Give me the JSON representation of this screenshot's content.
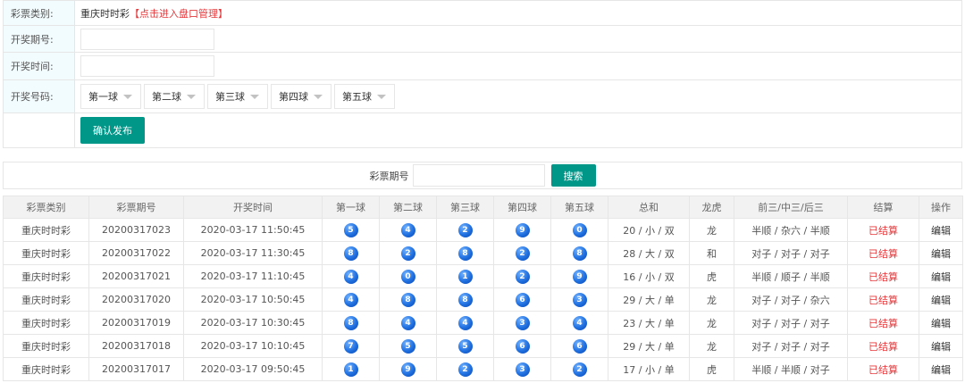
{
  "form": {
    "category_label": "彩票类别:",
    "category_value": "重庆时时彩",
    "category_link": "【点击进入盘口管理】",
    "issue_label": "开奖期号:",
    "time_label": "开奖时间:",
    "numbers_label": "开奖号码:",
    "ball_selects": [
      "第一球",
      "第二球",
      "第三球",
      "第四球",
      "第五球"
    ],
    "submit_label": "确认发布"
  },
  "search": {
    "label": "彩票期号",
    "button": "搜索"
  },
  "table": {
    "headers": [
      "彩票类别",
      "彩票期号",
      "开奖时间",
      "第一球",
      "第二球",
      "第三球",
      "第四球",
      "第五球",
      "总和",
      "龙虎",
      "前三/中三/后三",
      "结算",
      "操作"
    ],
    "rows": [
      {
        "category": "重庆时时彩",
        "issue": "20200317023",
        "time": "2020-03-17 11:50:45",
        "balls": [
          "5",
          "4",
          "2",
          "9",
          "0"
        ],
        "sum": "20 / 小 / 双",
        "dragon_tiger": "龙",
        "pattern": "半顺 / 杂六 / 半顺",
        "status": "已结算",
        "action": "编辑"
      },
      {
        "category": "重庆时时彩",
        "issue": "20200317022",
        "time": "2020-03-17 11:30:45",
        "balls": [
          "8",
          "2",
          "8",
          "2",
          "8"
        ],
        "sum": "28 / 大 / 双",
        "dragon_tiger": "和",
        "pattern": "对子 / 对子 / 对子",
        "status": "已结算",
        "action": "编辑"
      },
      {
        "category": "重庆时时彩",
        "issue": "20200317021",
        "time": "2020-03-17 11:10:45",
        "balls": [
          "4",
          "0",
          "1",
          "2",
          "9"
        ],
        "sum": "16 / 小 / 双",
        "dragon_tiger": "虎",
        "pattern": "半顺 / 顺子 / 半顺",
        "status": "已结算",
        "action": "编辑"
      },
      {
        "category": "重庆时时彩",
        "issue": "20200317020",
        "time": "2020-03-17 10:50:45",
        "balls": [
          "4",
          "8",
          "8",
          "6",
          "3"
        ],
        "sum": "29 / 大 / 单",
        "dragon_tiger": "龙",
        "pattern": "对子 / 对子 / 杂六",
        "status": "已结算",
        "action": "编辑"
      },
      {
        "category": "重庆时时彩",
        "issue": "20200317019",
        "time": "2020-03-17 10:30:45",
        "balls": [
          "8",
          "4",
          "4",
          "3",
          "4"
        ],
        "sum": "23 / 大 / 单",
        "dragon_tiger": "龙",
        "pattern": "对子 / 对子 / 对子",
        "status": "已结算",
        "action": "编辑"
      },
      {
        "category": "重庆时时彩",
        "issue": "20200317018",
        "time": "2020-03-17 10:10:45",
        "balls": [
          "7",
          "5",
          "5",
          "6",
          "6"
        ],
        "sum": "29 / 大 / 单",
        "dragon_tiger": "龙",
        "pattern": "对子 / 对子 / 对子",
        "status": "已结算",
        "action": "编辑"
      },
      {
        "category": "重庆时时彩",
        "issue": "20200317017",
        "time": "2020-03-17 09:50:45",
        "balls": [
          "1",
          "9",
          "2",
          "3",
          "2"
        ],
        "sum": "17 / 小 / 单",
        "dragon_tiger": "虎",
        "pattern": "半顺 / 半顺 / 对子",
        "status": "已结算",
        "action": "编辑"
      }
    ]
  },
  "colors": {
    "accent": "#009688",
    "link": "#e4393c",
    "ball": "#1f6fe0",
    "label_bg": "#f2fbfd"
  }
}
